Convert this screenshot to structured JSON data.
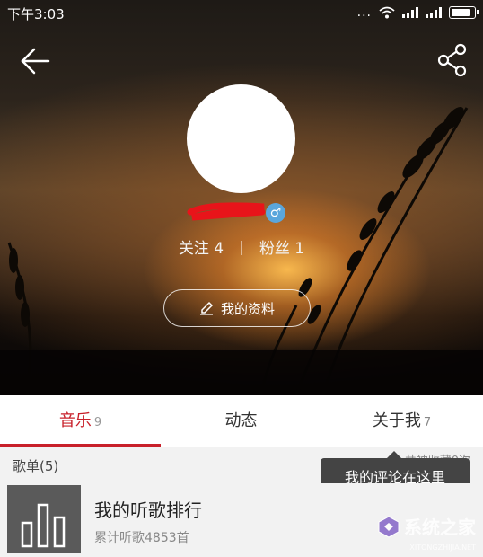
{
  "status": {
    "time": "下午3:03",
    "dots": "..."
  },
  "header": {
    "back_icon": "back-arrow-icon",
    "share_icon": "share-icon"
  },
  "profile": {
    "following_label": "关注 4",
    "followers_label": "粉丝 1",
    "gender_icon": "male-icon",
    "gender_symbol": "♂",
    "edit_button_label": "我的资料"
  },
  "tabs": [
    {
      "label": "音乐",
      "count": "9"
    },
    {
      "label": "动态",
      "count": ""
    },
    {
      "label": "关于我",
      "count": "7"
    }
  ],
  "section": {
    "title": "歌单(5)",
    "right_text": "共被收藏0次"
  },
  "tooltip": {
    "text": "我的评论在这里"
  },
  "playlist": {
    "title": "我的听歌排行",
    "subtitle": "累计听歌4853首"
  },
  "watermark": {
    "text": "系统之家",
    "url": "XITONGZHIJIA.NET"
  },
  "colors": {
    "accent": "#c8202a",
    "gender": "#5aa6dc",
    "tooltip_bg": "#444444"
  }
}
